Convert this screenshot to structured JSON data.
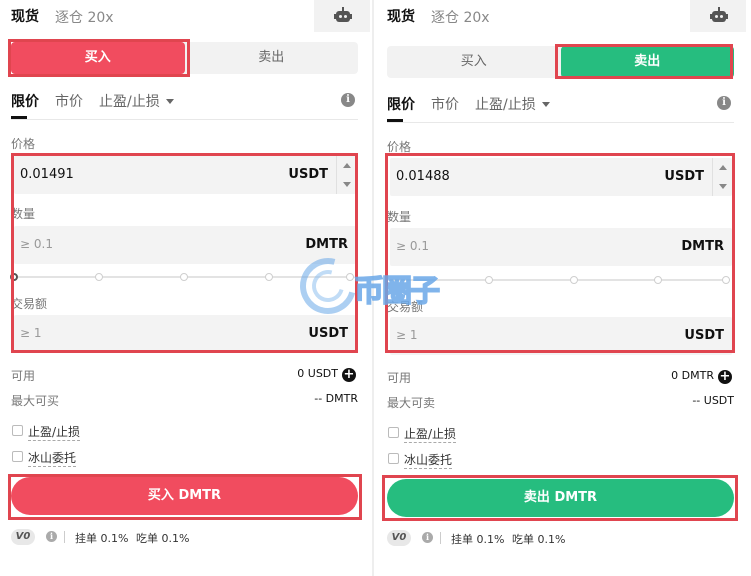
{
  "header": {
    "spot": "现货",
    "isolated": "逐仓 20x",
    "robot_icon": "robot-icon"
  },
  "buy_panel": {
    "tab_buy": "买入",
    "tab_sell": "卖出",
    "order_types": [
      "限价",
      "市价",
      "止盈/止损"
    ],
    "price_label": "价格",
    "price_value": "0.01491",
    "price_unit": "USDT",
    "amount_label": "数量",
    "amount_placeholder": "≥ 0.1",
    "amount_unit": "DMTR",
    "total_label": "交易额",
    "total_placeholder": "≥ 1",
    "total_unit": "USDT",
    "available_label": "可用",
    "available_value": "0 USDT",
    "max_label": "最大可买",
    "max_value": "-- DMTR",
    "tpsl_label": "止盈/止损",
    "iceberg_label": "冰山委托",
    "submit_label": "买入 DMTR",
    "vip_badge": "V0",
    "maker_fee": "挂单 0.1%",
    "taker_fee": "吃单 0.1%"
  },
  "sell_panel": {
    "tab_buy": "买入",
    "tab_sell": "卖出",
    "order_types": [
      "限价",
      "市价",
      "止盈/止损"
    ],
    "price_label": "价格",
    "price_value": "0.01488",
    "price_unit": "USDT",
    "amount_label": "数量",
    "amount_placeholder": "≥ 0.1",
    "amount_unit": "DMTR",
    "total_label": "交易额",
    "total_placeholder": "≥ 1",
    "total_unit": "USDT",
    "available_label": "可用",
    "available_value": "0 DMTR",
    "max_label": "最大可卖",
    "max_value": "-- USDT",
    "tpsl_label": "止盈/止损",
    "iceberg_label": "冰山委托",
    "submit_label": "卖出 DMTR",
    "vip_badge": "V0",
    "maker_fee": "挂单 0.1%",
    "taker_fee": "吃单 0.1%"
  },
  "watermark_text": "币圈子",
  "colors": {
    "buy": "#f14c5f",
    "sell": "#26bd7f",
    "highlight": "#e0454f"
  }
}
